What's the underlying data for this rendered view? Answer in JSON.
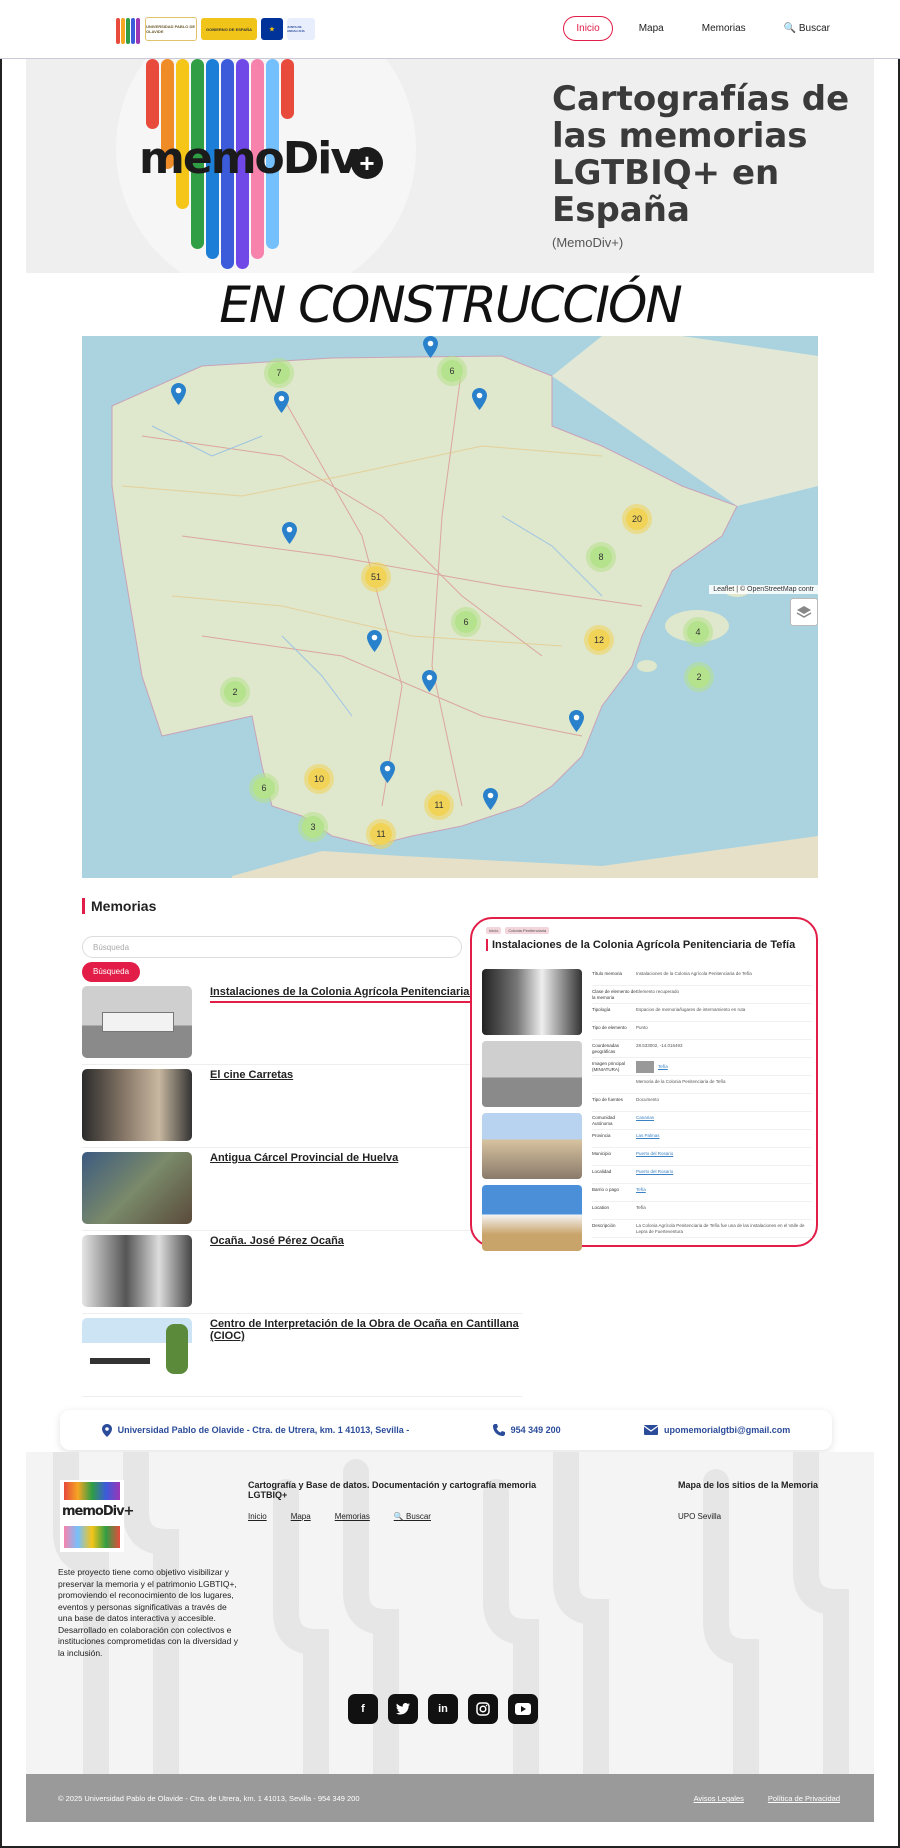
{
  "header": {
    "brand_small": "memoDiv+",
    "sponsors": [
      "UNIVERSIDAD PABLO DE OLAVIDE",
      "GOBIERNO DE ESPAÑA",
      "UNIÓN EUROPEA",
      "JUNTA DE ANDALUCÍA"
    ],
    "nav": [
      {
        "label": "Inicio",
        "active": true
      },
      {
        "label": "Mapa",
        "active": false
      },
      {
        "label": "Memorias",
        "active": false
      },
      {
        "label": "Buscar",
        "active": false
      }
    ]
  },
  "hero": {
    "brand": "memoDiv",
    "title": "Cartografías de las memorias LGTBIQ+ en España",
    "subtitle": "(MemoDiv+)"
  },
  "banner": "EN CONSTRUCCIÓN",
  "map": {
    "clusters": [
      {
        "count": "7",
        "color": "green"
      },
      {
        "count": "6",
        "color": "green"
      },
      {
        "count": "20",
        "color": "yellow"
      },
      {
        "count": "8",
        "color": "green"
      },
      {
        "count": "51",
        "color": "yellow"
      },
      {
        "count": "6",
        "color": "green"
      },
      {
        "count": "12",
        "color": "yellow"
      },
      {
        "count": "4",
        "color": "green"
      },
      {
        "count": "2",
        "color": "green"
      },
      {
        "count": "2",
        "color": "green"
      },
      {
        "count": "10",
        "color": "yellow"
      },
      {
        "count": "6",
        "color": "green"
      },
      {
        "count": "11",
        "color": "yellow"
      },
      {
        "count": "3",
        "color": "green"
      },
      {
        "count": "11",
        "color": "yellow"
      }
    ],
    "attribution": "Leaflet | © OpenStreetMap contr"
  },
  "memorias": {
    "title": "Memorias",
    "search_placeholder": "Búsqueda",
    "search_button": "Búsqueda",
    "items": [
      "Instalaciones de la Colonia Agrícola Penitenciaria de Tefía",
      "El cine Carretas",
      "Antigua Cárcel Provincial de Huelva",
      "Ocaña. José Pérez Ocaña",
      "Centro de Interpretación de la Obra de Ocaña en Cantillana (CIOC)"
    ]
  },
  "detail": {
    "crumbs": [
      "Inicio",
      "Colonia Penitenciaria"
    ],
    "title": "Instalaciones de la Colonia Agrícola Penitenciaria de Tefía",
    "rows": [
      {
        "k": "Título memoria",
        "v": "Instalaciones de la Colonia Agrícola Penitenciaria de Tefía",
        "link": false
      },
      {
        "k": "Clase de elemento de la memoria",
        "v": "Elemento recuperado",
        "link": false
      },
      {
        "k": "Tipología",
        "v": "Espacios de memoria/lugares de internamiento en ruta",
        "link": false
      },
      {
        "k": "Tipo de elemento",
        "v": "Punto",
        "link": false
      },
      {
        "k": "Coordenadas geográficas",
        "v": "28.533002, -14.016493",
        "link": false
      },
      {
        "k": "Imagen principal (MINIATURA)",
        "v": "Tefía",
        "link": true
      },
      {
        "k": "",
        "v": "Memoria de la Colonia Penitenciaria de Tefía",
        "link": false
      },
      {
        "k": "Tipo de fuentes",
        "v": "Documento",
        "link": false
      },
      {
        "k": "Comunidad Autónoma",
        "v": "Canarias",
        "link": true
      },
      {
        "k": "Provincia",
        "v": "Las Palmas",
        "link": true
      },
      {
        "k": "Municipio",
        "v": "Puerto del Rosario",
        "link": true
      },
      {
        "k": "Localidad",
        "v": "Puerto del Rosario",
        "link": true
      },
      {
        "k": "Barrio o pago",
        "v": "Tefía",
        "link": true
      },
      {
        "k": "Location",
        "v": "Tefía",
        "link": false
      },
      {
        "k": "Descripción",
        "v": "La Colonia Agrícola Penitenciaria de Tefía fue una de las instalaciones en el Valle de Lepra de Fuerteventura",
        "link": false
      }
    ]
  },
  "contact": {
    "address": "Universidad Pablo de Olavide - Ctra. de Utrera, km. 1 41013, Sevilla -",
    "phone": "954 349 200",
    "email": "upomemorialgtbi@gmail.com"
  },
  "footer": {
    "description": "Este proyecto tiene como objetivo visibilizar y preservar la memoria y el patrimonio LGBTIQ+, promoviendo el reconocimiento de los lugares, eventos y personas significativas a través de una base de datos interactiva y accesible. Desarrollado en colaboración con colectivos e instituciones comprometidas con la diversidad y la inclusión.",
    "col2_title": "Cartografía y Base de datos. Documentación y cartografía memoria LGTBIQ+",
    "links": [
      "Inicio",
      "Mapa",
      "Memorias",
      "Buscar"
    ],
    "col3_title": "Mapa de los sitios de la Memoria",
    "col3_item": "UPO Sevilla",
    "socials": [
      "f",
      "t",
      "in",
      "ig",
      "yt"
    ],
    "copyright": "© 2025 Universidad Pablo de Olavide - Ctra. de Utrera, km. 1 41013, Sevilla - 954 349 200",
    "legal": [
      "Avisos Legales",
      "Política de Privacidad"
    ]
  },
  "colors": {
    "accent": "#e11d48",
    "link": "#2b4c9a",
    "map_land": "#d4e6bf",
    "map_sea": "#aad3df"
  }
}
